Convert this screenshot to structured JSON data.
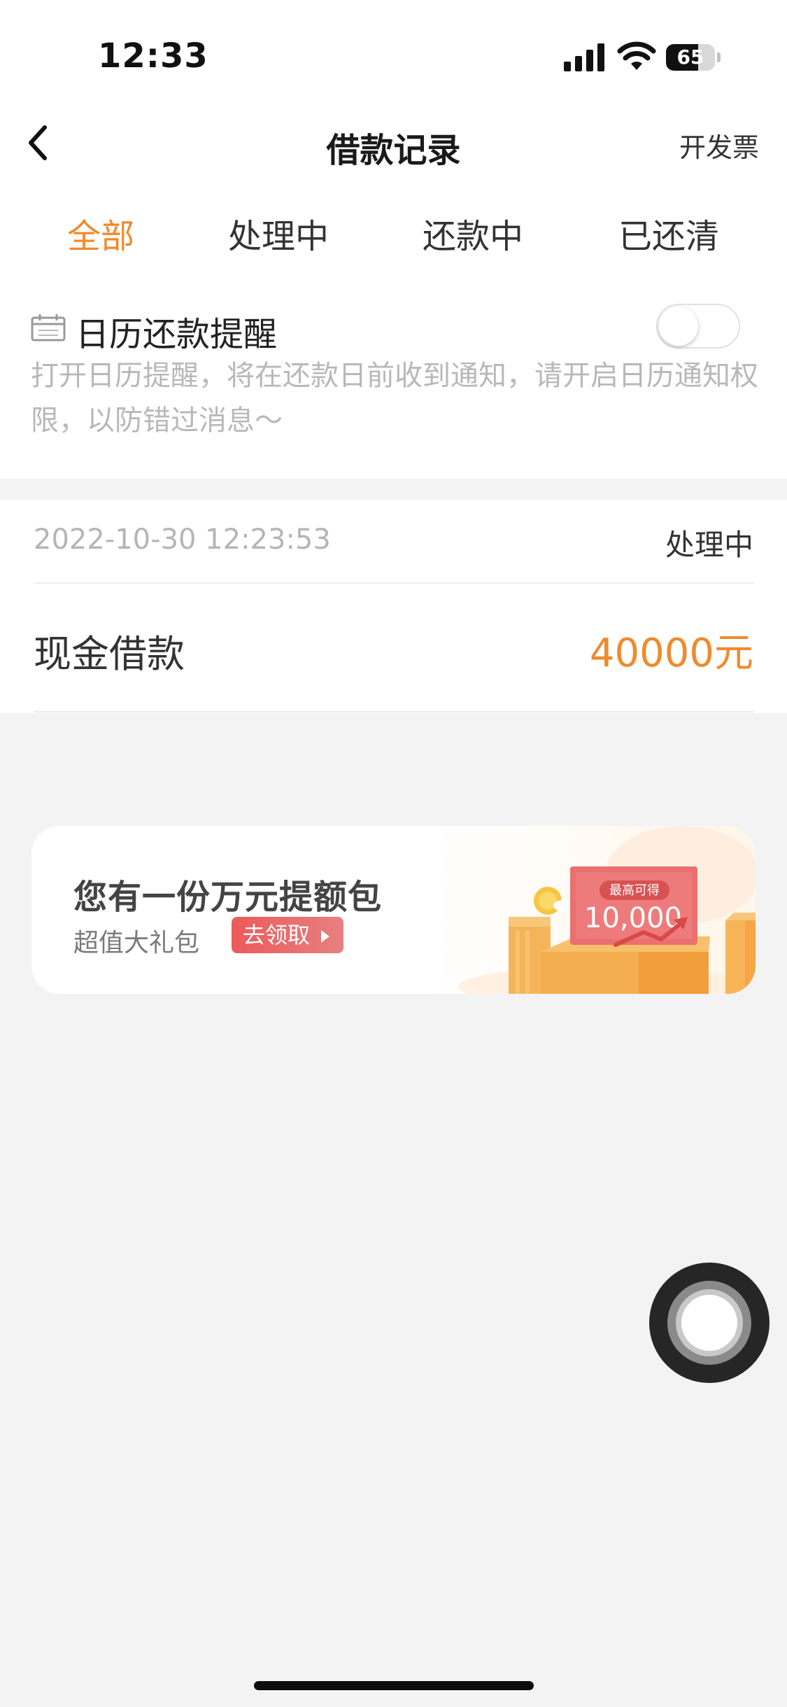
{
  "status_bar": {
    "time": "12:33",
    "battery": "65",
    "battery_level": 0.65
  },
  "nav": {
    "title": "借款记录",
    "right_action": "开发票"
  },
  "tabs": [
    {
      "label": "全部",
      "active": true
    },
    {
      "label": "处理中",
      "active": false
    },
    {
      "label": "还款中",
      "active": false
    },
    {
      "label": "已还清",
      "active": false
    }
  ],
  "reminder": {
    "title": "日历还款提醒",
    "description": "打开日历提醒，将在还款日前收到通知，请开启日历通知权限，以防错过消息～",
    "enabled": false
  },
  "records": [
    {
      "datetime": "2022-10-30 12:23:53",
      "status": "处理中",
      "type": "现金借款",
      "amount": "40000元"
    }
  ],
  "banner": {
    "title": "您有一份万元提额包",
    "subtitle": "超值大礼包",
    "button_label": "去领取",
    "badge_label": "最高可得",
    "badge_value": "10,000"
  },
  "colors": {
    "accent": "#f08a2c",
    "banner_button": "#ec5a5a",
    "background": "#f3f3f3"
  },
  "icons": [
    "back-chevron-icon",
    "calendar-icon",
    "signal-icon",
    "wifi-icon",
    "battery-icon",
    "play-triangle-icon"
  ]
}
